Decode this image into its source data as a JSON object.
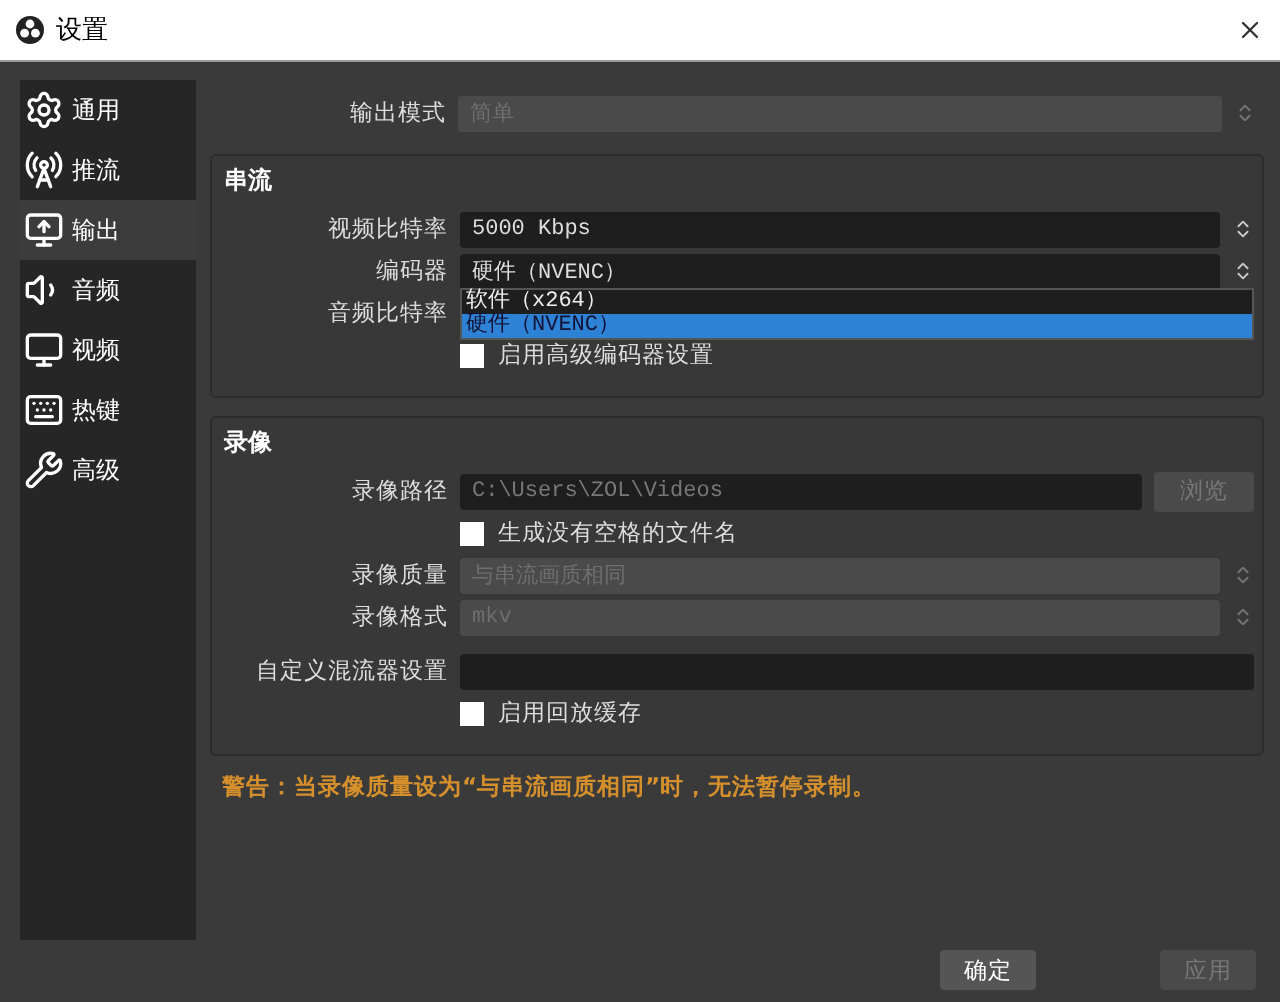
{
  "window": {
    "title": "设置"
  },
  "sidebar": {
    "items": [
      {
        "label": "通用",
        "selected": false
      },
      {
        "label": "推流",
        "selected": false
      },
      {
        "label": "输出",
        "selected": true
      },
      {
        "label": "音频",
        "selected": false
      },
      {
        "label": "视频",
        "selected": false
      },
      {
        "label": "热键",
        "selected": false
      },
      {
        "label": "高级",
        "selected": false
      }
    ]
  },
  "output_mode": {
    "label": "输出模式",
    "value": "简单",
    "disabled": true
  },
  "groups": [
    {
      "title": "串流",
      "rows": [
        {
          "kind": "spin",
          "label": "视频比特率",
          "value": "5000 Kbps",
          "disabled": false
        },
        {
          "kind": "select",
          "label": "编码器",
          "value": "硬件（NVENC）",
          "disabled": false,
          "expanded": true,
          "options": [
            {
              "label": "软件（x264）",
              "selected": false
            },
            {
              "label": "硬件（NVENC）",
              "selected": true
            }
          ]
        },
        {
          "kind": "label",
          "label": "音频比特率"
        },
        {
          "kind": "checkbox",
          "text": "启用高级编码器设置",
          "checked": false
        }
      ]
    },
    {
      "title": "录像",
      "rows": [
        {
          "kind": "path",
          "label": "录像路径",
          "value": "C:\\Users\\ZOL\\Videos",
          "button": "浏览",
          "disabled": true
        },
        {
          "kind": "checkbox",
          "text": "生成没有空格的文件名",
          "checked": false
        },
        {
          "kind": "select",
          "label": "录像质量",
          "value": "与串流画质相同",
          "disabled": true
        },
        {
          "kind": "select",
          "label": "录像格式",
          "value": "mkv",
          "disabled": true
        },
        {
          "kind": "text",
          "label": "自定义混流器设置"
        },
        {
          "kind": "checkbox",
          "text": "启用回放缓存",
          "checked": false
        }
      ]
    }
  ],
  "warning": "警告：当录像质量设为“与串流画质相同”时，无法暂停录制。",
  "buttons": [
    {
      "label": "确定",
      "disabled": false
    },
    {
      "label": "应用",
      "disabled": true
    }
  ]
}
